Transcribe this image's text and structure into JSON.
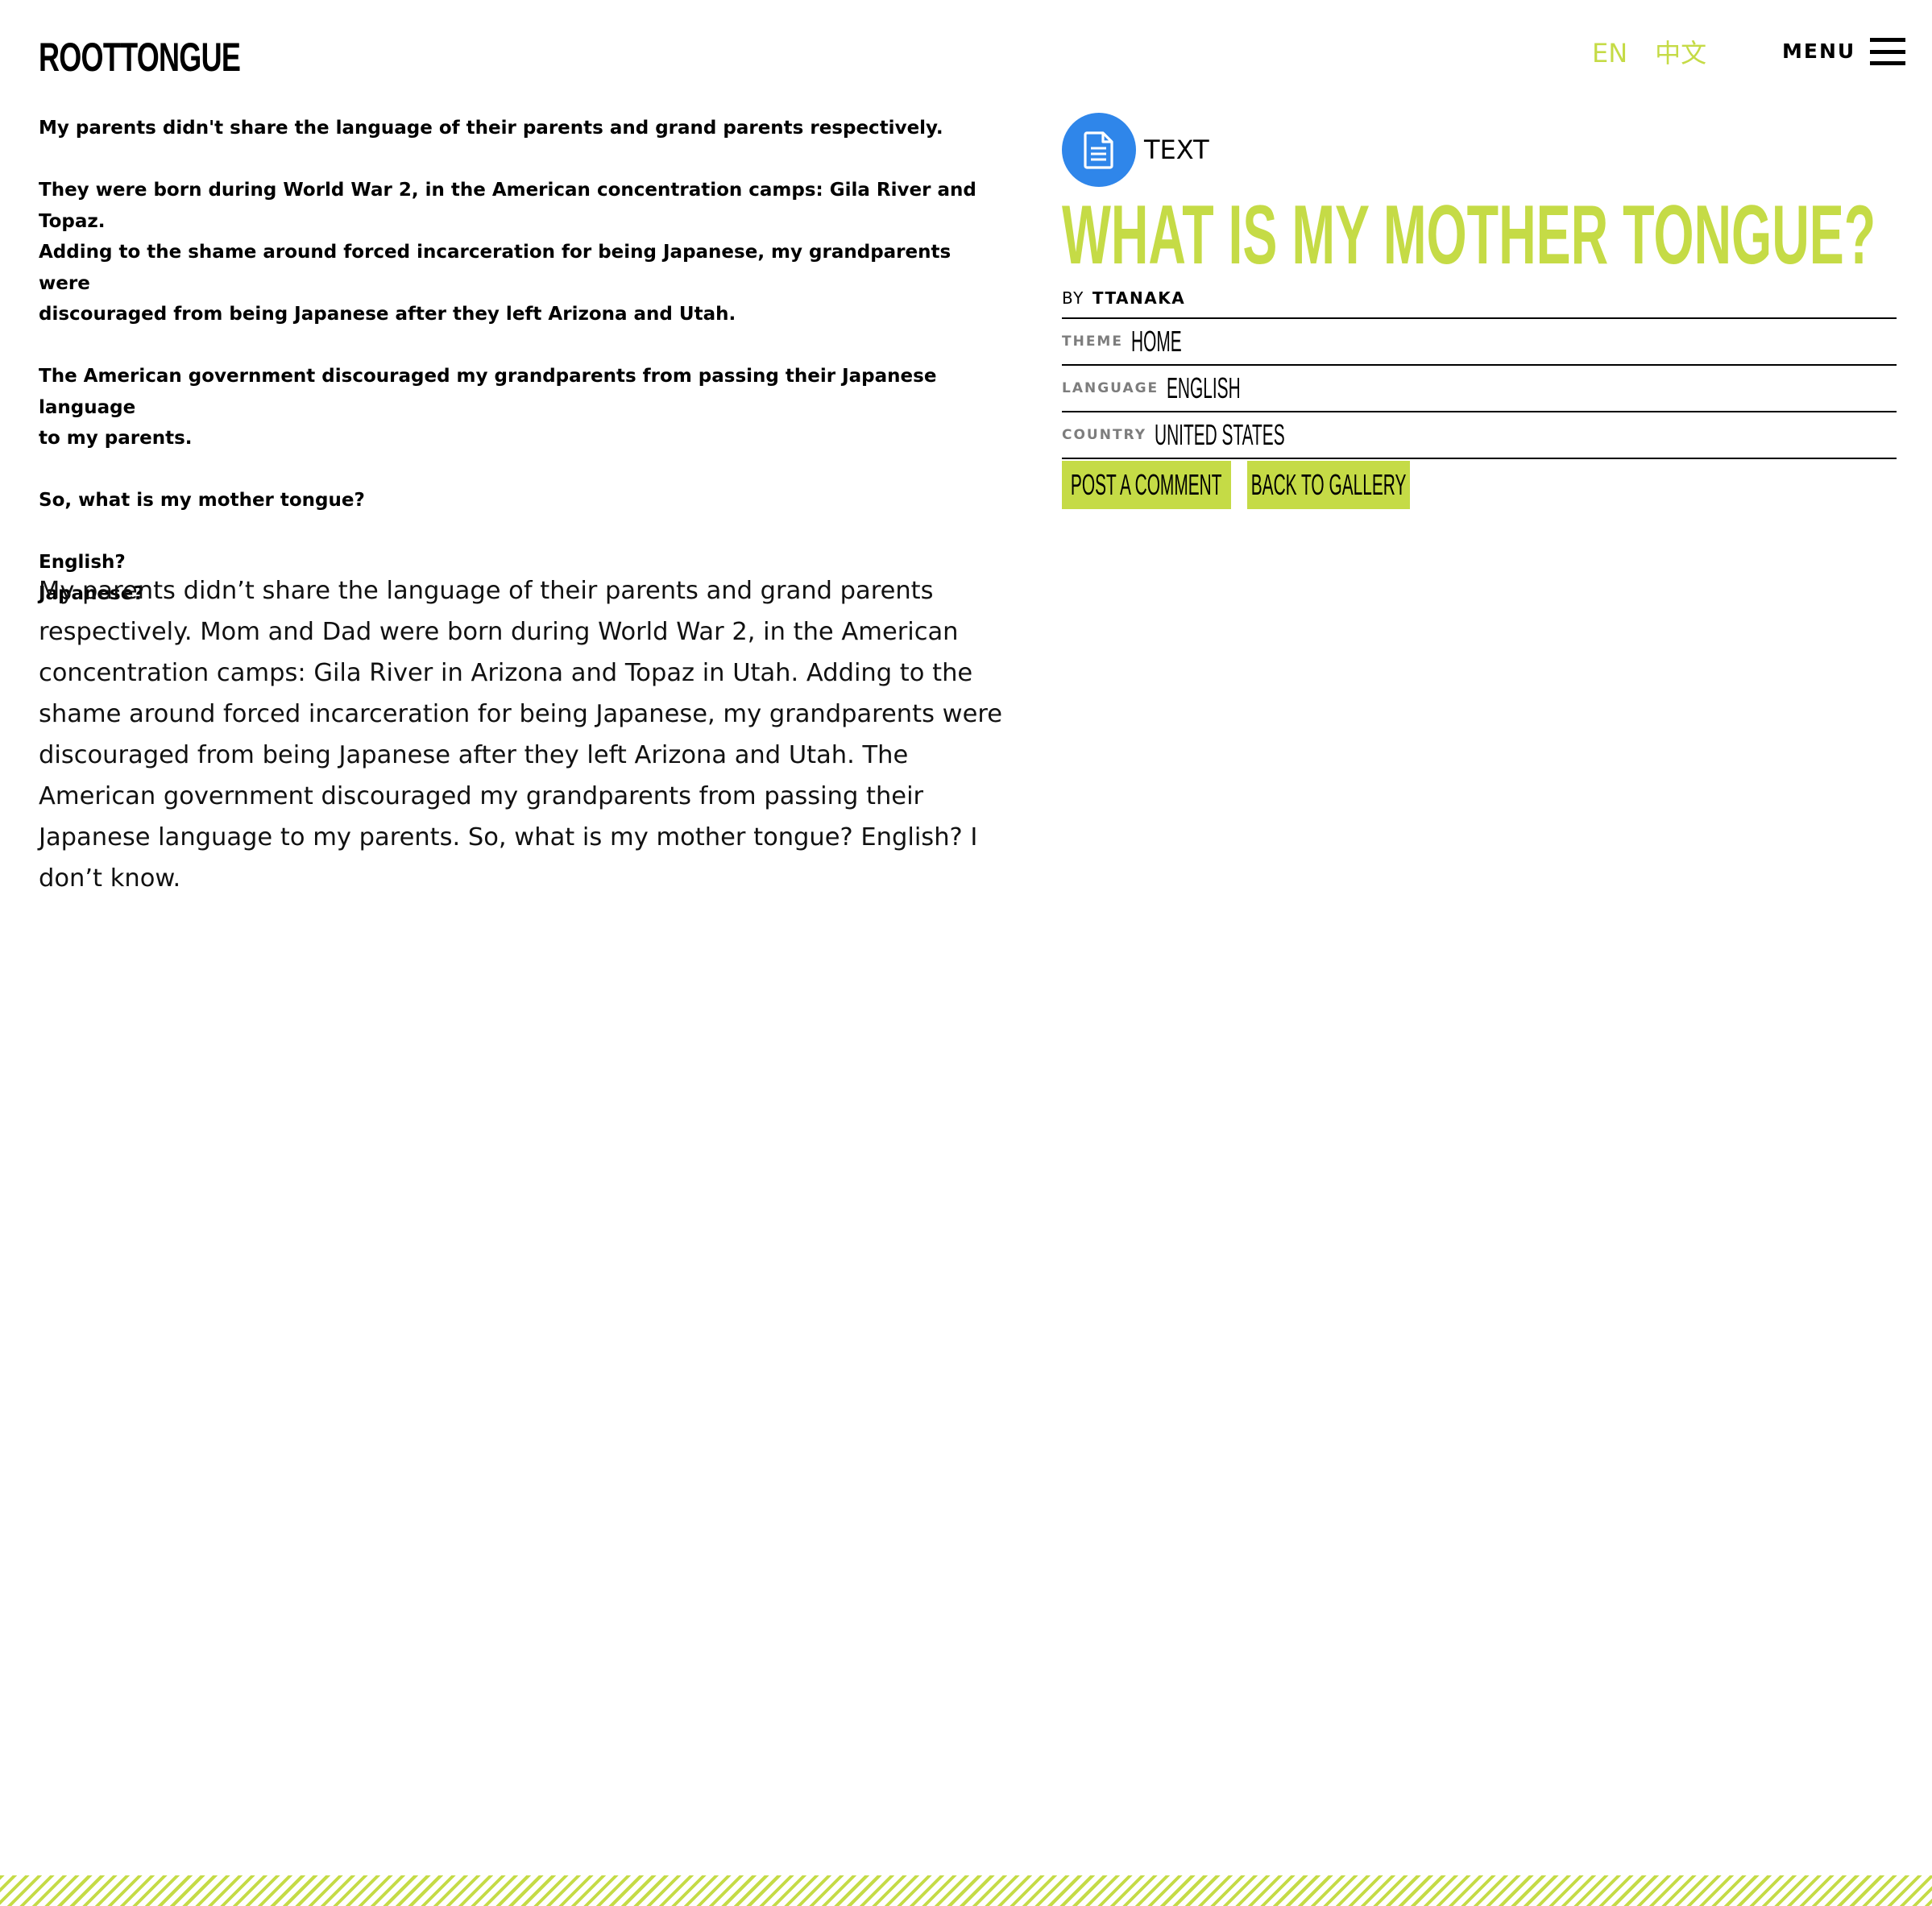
{
  "header": {
    "logo_text": "ROOTTONGUE",
    "languages": [
      "EN",
      "中文"
    ],
    "menu_label": "MENU"
  },
  "intro": {
    "paragraphs": [
      "My parents didn't share the language of their parents and grand parents respectively.",
      "They were born during World War 2, in the American concentration camps: Gila River and Topaz.\nAdding to the shame around forced incarceration for being Japanese, my grandparents were\ndiscouraged from being Japanese after they left Arizona and Utah.",
      "The American government discouraged my grandparents from passing their Japanese language\nto my parents.",
      "So, what is my mother tongue?",
      "English?\nJapanese?"
    ]
  },
  "story": "My parents didn’t share the language of their parents and grand parents respectively. Mom and Dad were born during World War 2, in the American concentration camps: Gila River in Arizona and Topaz in Utah. Adding to the shame around forced incarceration for being Japanese, my grandparents were discouraged from being Japanese after they left Arizona and Utah. The American government discouraged my grandparents from passing their Japanese language to my parents. So, what is my mother tongue? English? I don’t know.",
  "entry": {
    "type_label": "TEXT",
    "type_icon": "document-icon",
    "title": "WHAT IS MY MOTHER TONGUE?",
    "by_label": "BY",
    "author": "TTANAKA",
    "meta": {
      "theme_label": "THEME",
      "theme_value": "HOME",
      "language_label": "LANGUAGE",
      "language_value": "ENGLISH",
      "country_label": "COUNTRY",
      "country_value": "UNITED STATES"
    },
    "buttons": {
      "comment": "POST A COMMENT",
      "gallery": "BACK TO GALLERY"
    }
  },
  "colors": {
    "accent": "#c5db46",
    "icon_blue": "#2f86ea",
    "meta_label_gray": "#7d7d7d"
  }
}
